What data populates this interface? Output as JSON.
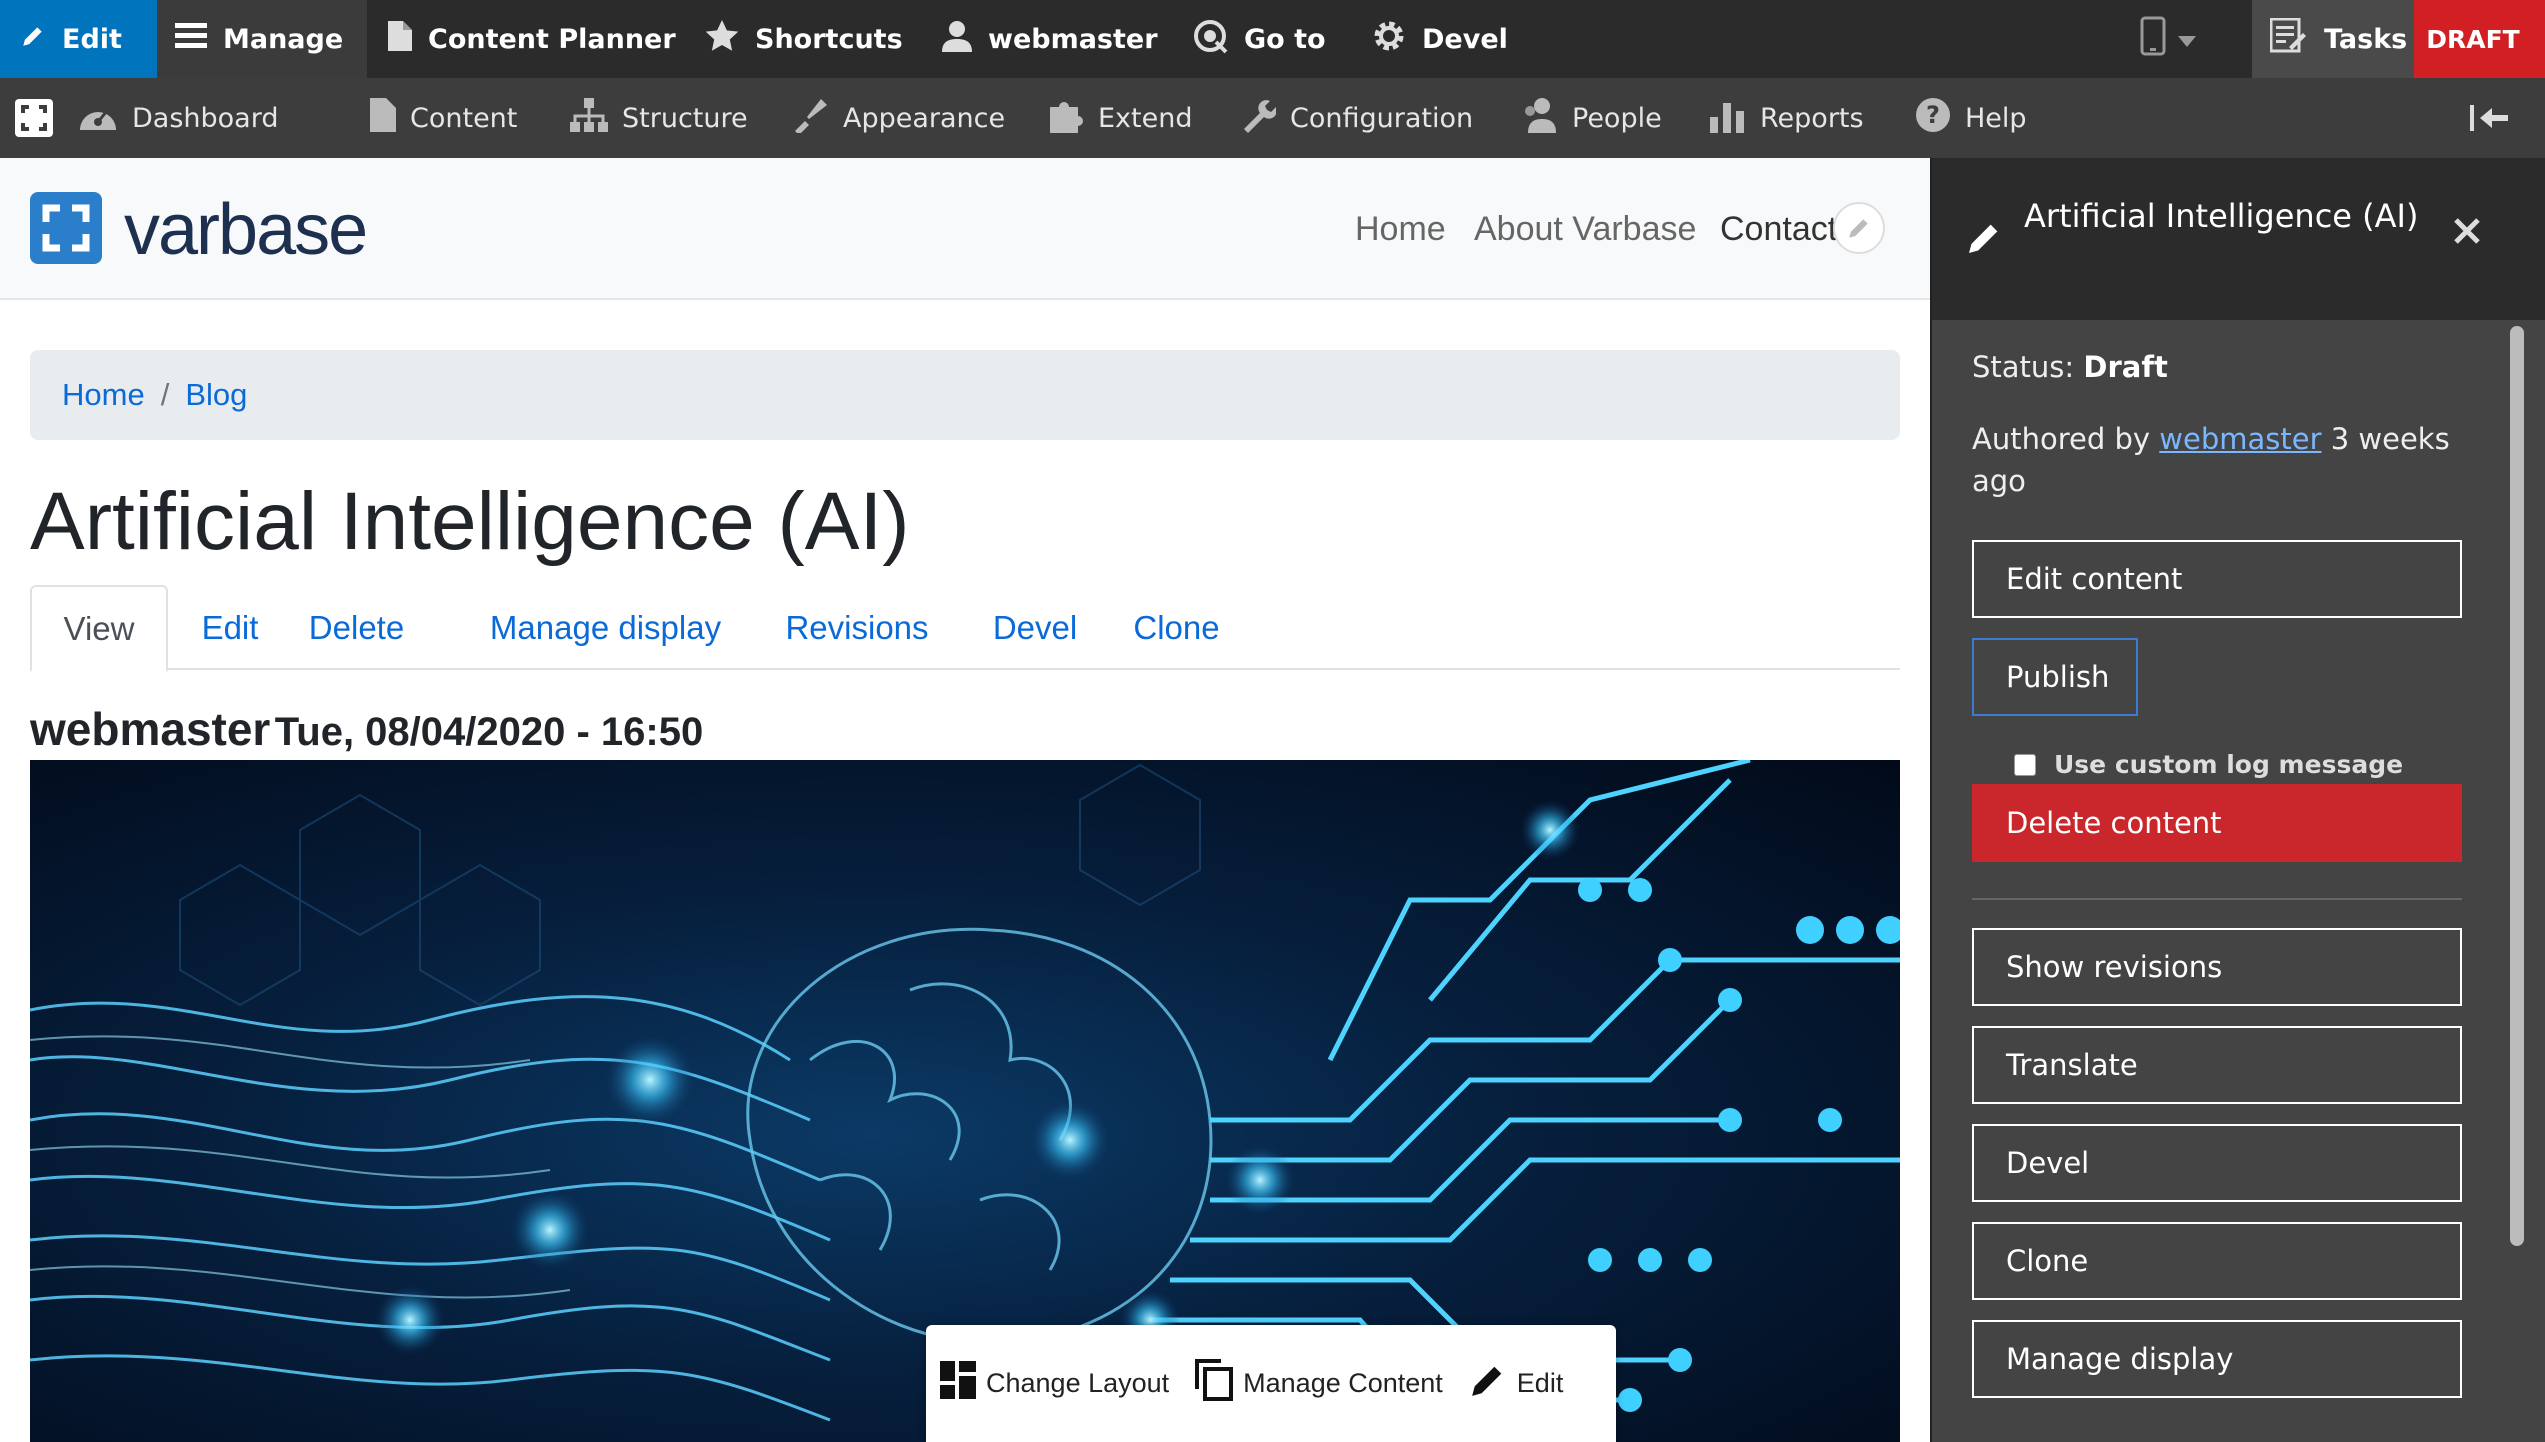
{
  "toolbar": {
    "edit": "Edit",
    "manage": "Manage",
    "content_planner": "Content Planner",
    "shortcuts": "Shortcuts",
    "user": "webmaster",
    "goto": "Go to",
    "devel": "Devel",
    "tasks": "Tasks",
    "draft": "DRAFT",
    "colors": {
      "edit_bg": "#0074bd",
      "draft_bg": "#d11f24",
      "bar_bg": "#2b2b2b"
    }
  },
  "admin_menu": {
    "items": [
      "Dashboard",
      "Content",
      "Structure",
      "Appearance",
      "Extend",
      "Configuration",
      "People",
      "Reports",
      "Help"
    ]
  },
  "site": {
    "logo": {
      "part1": "var",
      "part2": "base"
    },
    "nav": [
      "Home",
      "About Varbase",
      "Contact"
    ]
  },
  "breadcrumb": {
    "items": [
      "Home",
      "Blog"
    ],
    "separator": "/"
  },
  "page": {
    "title": "Artificial Intelligence (AI)",
    "tabs": [
      "View",
      "Edit",
      "Delete",
      "Manage display",
      "Revisions",
      "Devel",
      "Clone"
    ],
    "author": "webmaster",
    "date": "Tue, 08/04/2020 - 16:50",
    "hero_icon": "ai-brain-circuit-image"
  },
  "layout_builder_toolbar": {
    "change_layout": "Change Layout",
    "manage_content": "Manage Content",
    "edit": "Edit"
  },
  "sidebar": {
    "title": "Artificial Intelligence (AI)",
    "status_label": "Status:",
    "status_value": "Draft",
    "authored_prefix": "Authored by",
    "authored_user": "webmaster",
    "authored_suffix": "3 weeks ago",
    "edit_content": "Edit content",
    "publish": "Publish",
    "custom_log": "Use custom log message",
    "delete_content": "Delete content",
    "show_revisions": "Show revisions",
    "translate": "Translate",
    "devel": "Devel",
    "clone": "Clone",
    "manage_display": "Manage display"
  }
}
